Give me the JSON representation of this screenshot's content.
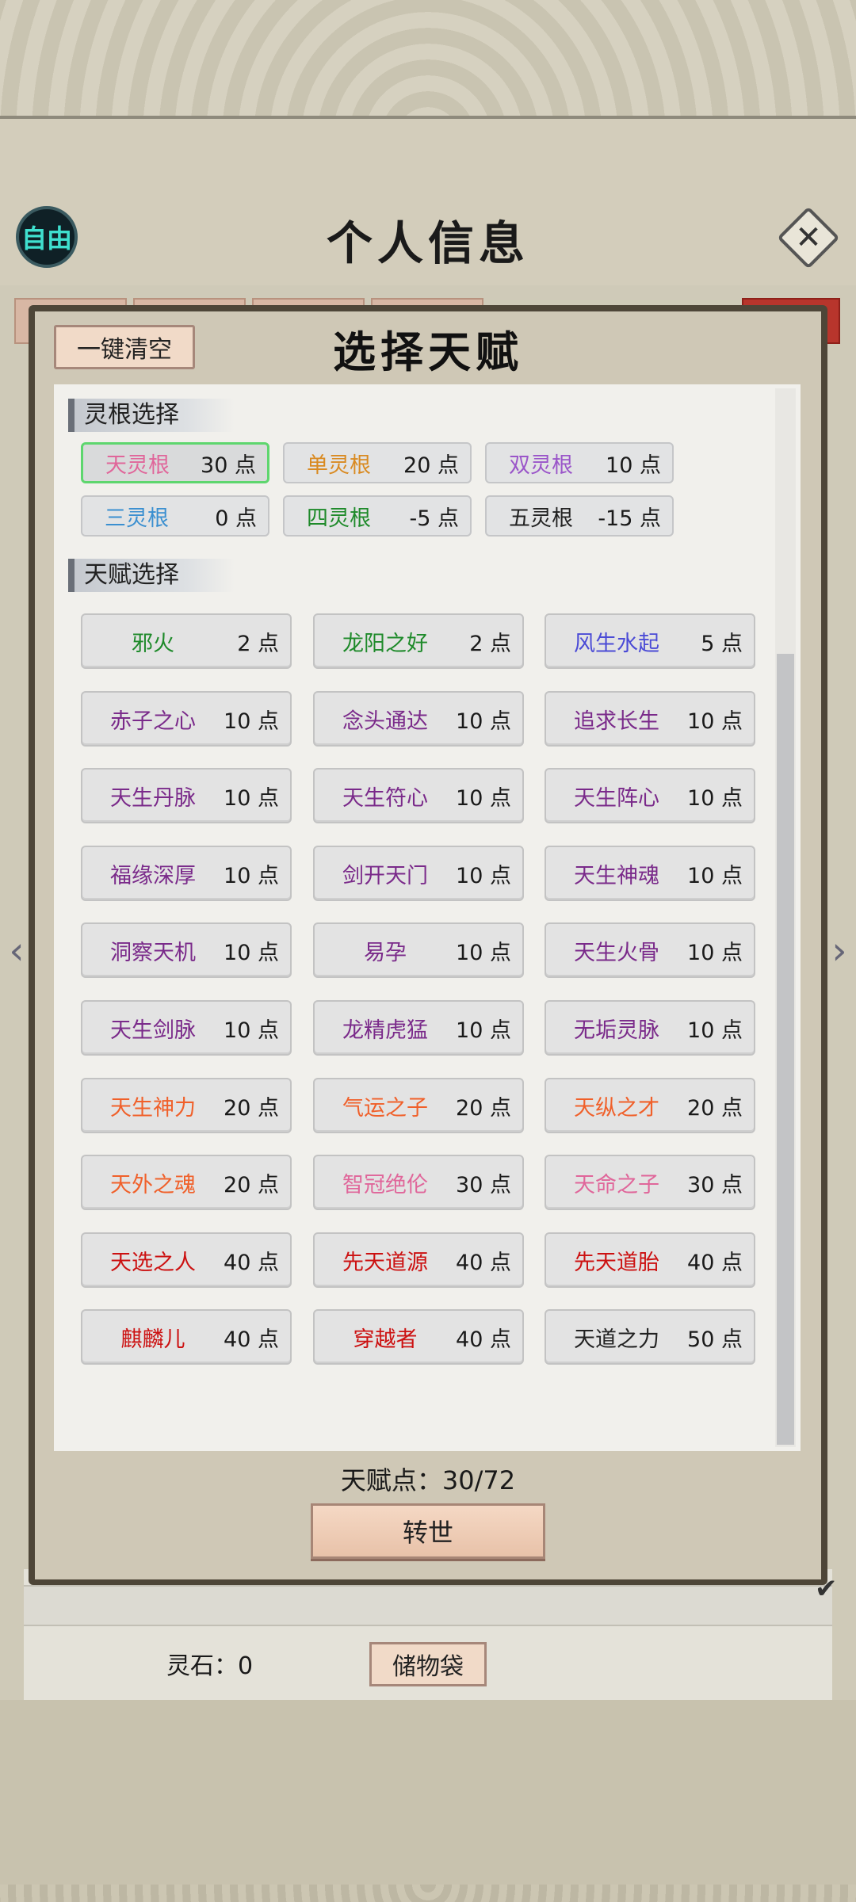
{
  "header": {
    "badge": "自由",
    "title": "个人信息",
    "close_icon": "close-icon"
  },
  "panel": {
    "clear_button": "一键清空",
    "title": "选择天赋"
  },
  "spirit_root": {
    "section_title": "灵根选择",
    "selected": "天灵根",
    "items": [
      {
        "name": "天灵根",
        "points": "30 点",
        "color": "#e0669a"
      },
      {
        "name": "单灵根",
        "points": "20 点",
        "color": "#d98a21"
      },
      {
        "name": "双灵根",
        "points": "10 点",
        "color": "#9a55c9"
      },
      {
        "name": "三灵根",
        "points": "0 点",
        "color": "#3a8fd0"
      },
      {
        "name": "四灵根",
        "points": "-5 点",
        "color": "#1e8a2a"
      },
      {
        "name": "五灵根",
        "points": "-15 点",
        "color": "#222222"
      }
    ]
  },
  "talents": {
    "section_title": "天赋选择",
    "items": [
      {
        "name": "邪火",
        "points": "2 点",
        "color": "#1e8a2a"
      },
      {
        "name": "龙阳之好",
        "points": "2 点",
        "color": "#1e8a2a"
      },
      {
        "name": "风生水起",
        "points": "5 点",
        "color": "#4b4bd6"
      },
      {
        "name": "赤子之心",
        "points": "10 点",
        "color": "#7a2a8a"
      },
      {
        "name": "念头通达",
        "points": "10 点",
        "color": "#7a2a8a"
      },
      {
        "name": "追求长生",
        "points": "10 点",
        "color": "#7a2a8a"
      },
      {
        "name": "天生丹脉",
        "points": "10 点",
        "color": "#7a2a8a"
      },
      {
        "name": "天生符心",
        "points": "10 点",
        "color": "#7a2a8a"
      },
      {
        "name": "天生阵心",
        "points": "10 点",
        "color": "#7a2a8a"
      },
      {
        "name": "福缘深厚",
        "points": "10 点",
        "color": "#7a2a8a"
      },
      {
        "name": "剑开天门",
        "points": "10 点",
        "color": "#7a2a8a"
      },
      {
        "name": "天生神魂",
        "points": "10 点",
        "color": "#7a2a8a"
      },
      {
        "name": "洞察天机",
        "points": "10 点",
        "color": "#7a2a8a"
      },
      {
        "name": "易孕",
        "points": "10 点",
        "color": "#7a2a8a"
      },
      {
        "name": "天生火骨",
        "points": "10 点",
        "color": "#7a2a8a"
      },
      {
        "name": "天生剑脉",
        "points": "10 点",
        "color": "#7a2a8a"
      },
      {
        "name": "龙精虎猛",
        "points": "10 点",
        "color": "#7a2a8a"
      },
      {
        "name": "无垢灵脉",
        "points": "10 点",
        "color": "#7a2a8a"
      },
      {
        "name": "天生神力",
        "points": "20 点",
        "color": "#f0602a"
      },
      {
        "name": "气运之子",
        "points": "20 点",
        "color": "#f0602a"
      },
      {
        "name": "天纵之才",
        "points": "20 点",
        "color": "#f0602a"
      },
      {
        "name": "天外之魂",
        "points": "20 点",
        "color": "#f0602a"
      },
      {
        "name": "智冠绝伦",
        "points": "30 点",
        "color": "#e0669a"
      },
      {
        "name": "天命之子",
        "points": "30 点",
        "color": "#e0669a"
      },
      {
        "name": "天选之人",
        "points": "40 点",
        "color": "#cc1111"
      },
      {
        "name": "先天道源",
        "points": "40 点",
        "color": "#cc1111"
      },
      {
        "name": "先天道胎",
        "points": "40 点",
        "color": "#cc1111"
      },
      {
        "name": "麒麟儿",
        "points": "40 点",
        "color": "#cc1111"
      },
      {
        "name": "穿越者",
        "points": "40 点",
        "color": "#cc1111"
      },
      {
        "name": "天道之力",
        "points": "50 点",
        "color": "#222222"
      }
    ]
  },
  "footer": {
    "talent_points": "天赋点：30/72",
    "reincarnate_button": "转世",
    "spirit_stone": "灵石：0",
    "storage_button": "储物袋"
  }
}
